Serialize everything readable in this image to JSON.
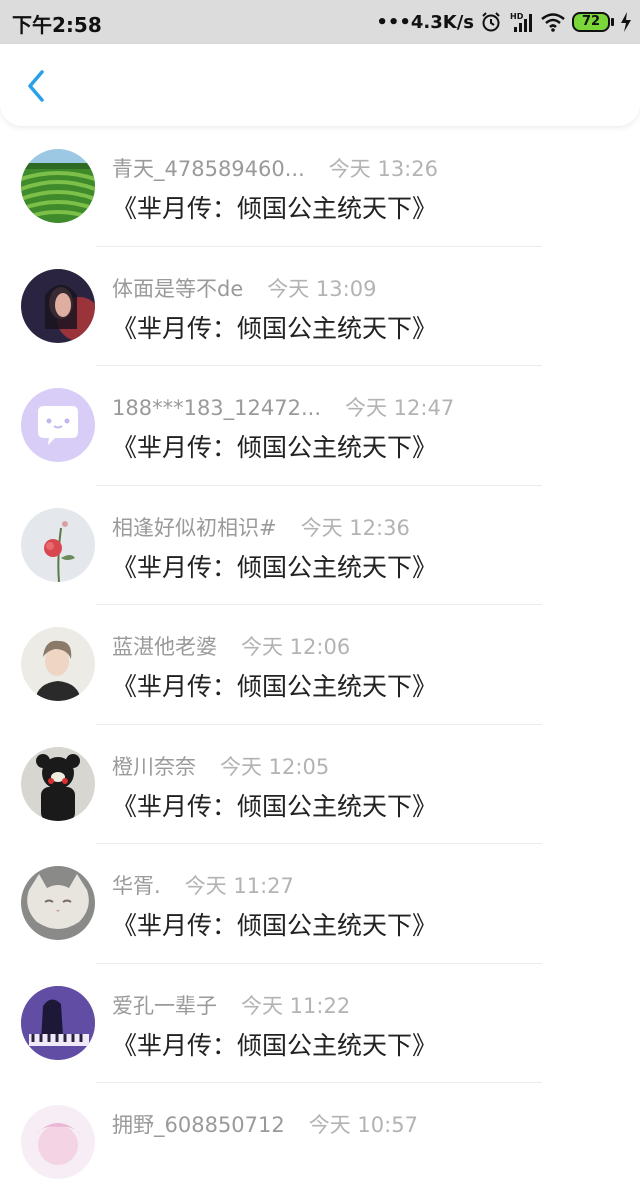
{
  "status_bar": {
    "time": "下午2:58",
    "network_speed": "•••4.3K/s",
    "battery_level": "72",
    "icons": [
      "alarm-icon",
      "hd-signal-icon",
      "wifi-icon",
      "battery-icon",
      "charging-icon"
    ]
  },
  "nav": {
    "back_icon": "chevron-left-icon",
    "accent_color": "#2aa0e8"
  },
  "messages": [
    {
      "username": "青天_478589460...",
      "time": "今天 13:26",
      "text": "《芈月传：倾国公主统天下》",
      "avatar": "tea-field"
    },
    {
      "username": "体面是等不de",
      "time": "今天 13:09",
      "text": "《芈月传：倾国公主统天下》",
      "avatar": "dark-portrait"
    },
    {
      "username": "188***183_12472...",
      "time": "今天 12:47",
      "text": "《芈月传：倾国公主统天下》",
      "avatar": "default-chat"
    },
    {
      "username": "相逢好似初相识#",
      "time": "今天 12:36",
      "text": "《芈月传：倾国公主统天下》",
      "avatar": "rose"
    },
    {
      "username": "蓝湛他老婆",
      "time": "今天 12:06",
      "text": "《芈月传：倾国公主统天下》",
      "avatar": "young-man"
    },
    {
      "username": "橙川奈奈",
      "time": "今天 12:05",
      "text": "《芈月传：倾国公主统天下》",
      "avatar": "kumamon"
    },
    {
      "username": "华胥.",
      "time": "今天 11:27",
      "text": "《芈月传：倾国公主统天下》",
      "avatar": "cat"
    },
    {
      "username": "爱孔一辈子",
      "time": "今天 11:22",
      "text": "《芈月传：倾国公主统天下》",
      "avatar": "piano"
    },
    {
      "username": "拥野_608850712",
      "time": "今天 10:57",
      "text": "",
      "avatar": "pink-anime"
    }
  ]
}
